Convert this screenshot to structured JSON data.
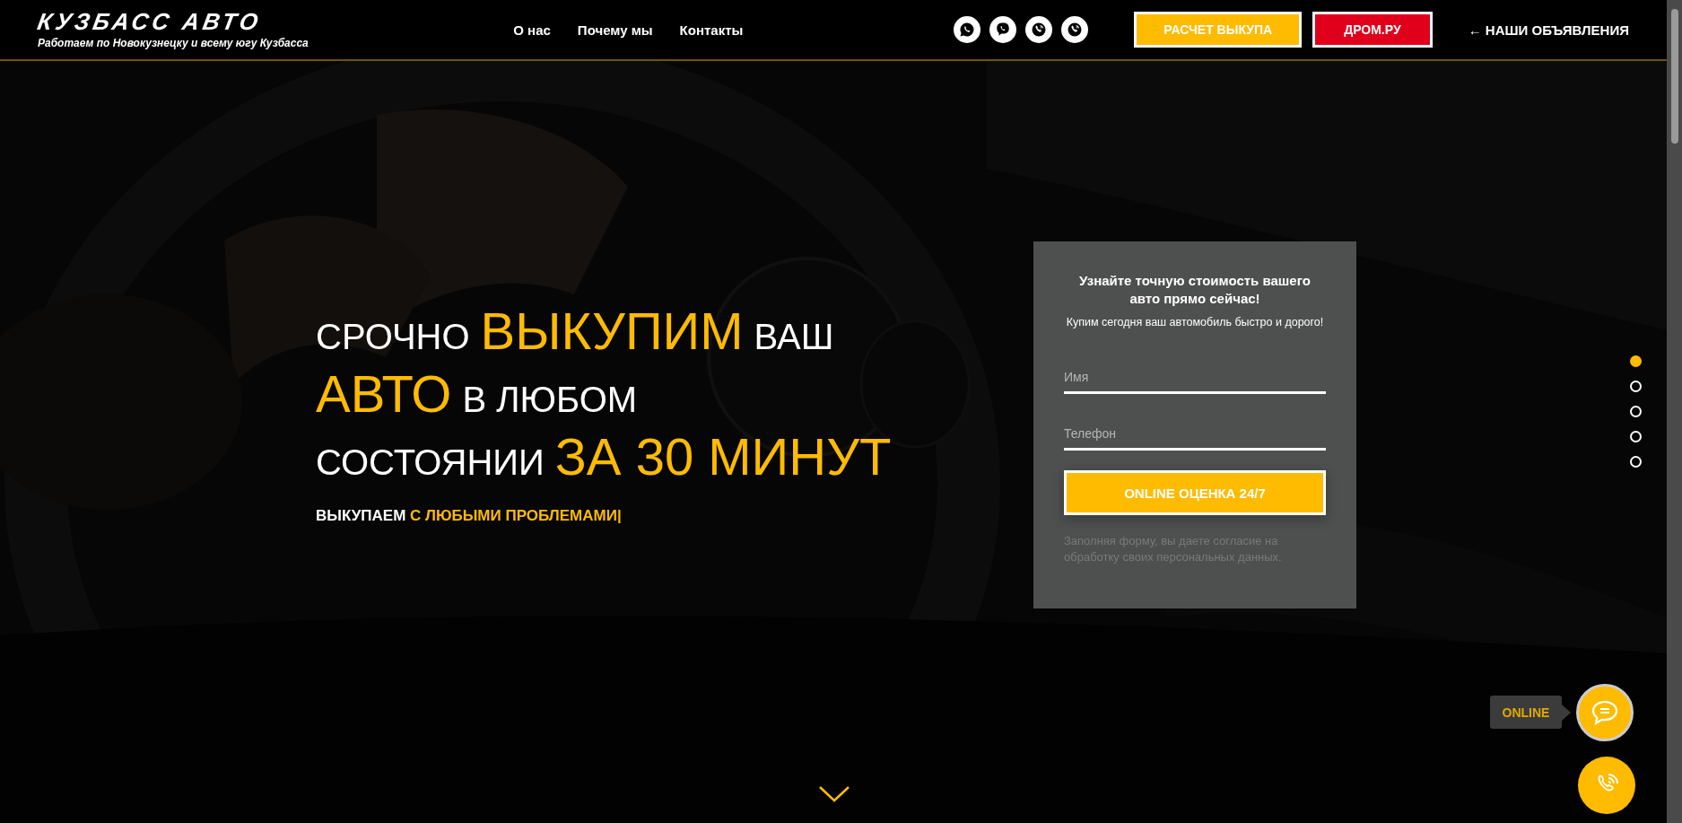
{
  "header": {
    "logo": {
      "title": "КУЗБАСС АВТО",
      "tagline": "Работаем по Новокузнецку и всему югу Кузбасса"
    },
    "nav": [
      "О нас",
      "Почему мы",
      "Контакты"
    ],
    "messengers": [
      {
        "kind": "whatsapp"
      },
      {
        "kind": "viber"
      },
      {
        "kind": "phone"
      },
      {
        "kind": "phone"
      }
    ],
    "buttons": [
      {
        "label": "РАСЧЕТ ВЫКУПА",
        "kind": "primary"
      },
      {
        "label": "ДРОМ.РУ",
        "kind": "danger"
      }
    ],
    "ads_link": "← НАШИ ОБЪЯВЛЕНИЯ"
  },
  "hero": {
    "headline": [
      [
        {
          "text": "СРОЧНО",
          "accent": false
        },
        {
          "text": "ВЫКУПИМ",
          "accent": true
        },
        {
          "text": "ВАШ",
          "accent": false
        }
      ],
      [
        {
          "text": "АВТО",
          "accent": true
        },
        {
          "text": "В ЛЮБОМ",
          "accent": false
        }
      ],
      [
        {
          "text": "СОСТОЯНИИ",
          "accent": false
        },
        {
          "text": "ЗА 30 МИНУТ",
          "accent": true
        }
      ]
    ],
    "subtitle": [
      {
        "text": "ВЫКУПАЕМ",
        "accent": false
      },
      {
        "text": "С ЛЮБЫМИ ПРОБЛЕМАМИ|",
        "accent": true
      }
    ],
    "scroll_hint": true
  },
  "form": {
    "title": "Узнайте точную стоимость вашего авто прямо сейчас!",
    "subtitle": "Купим сегодня ваш автомобиль быстро и дорого!",
    "fields": [
      {
        "placeholder": "Имя"
      },
      {
        "placeholder": "Телефон"
      }
    ],
    "submit": "ONLINE ОЦЕНКА 24/7",
    "consent": "Заполняя форму, вы даете согласие на обработку своих персональных данных."
  },
  "slide_dots": [
    {
      "selected": true
    },
    {
      "selected": false
    },
    {
      "selected": false
    },
    {
      "selected": false
    },
    {
      "selected": false
    }
  ],
  "widgets": {
    "chat_tooltip": "ONLINE"
  }
}
